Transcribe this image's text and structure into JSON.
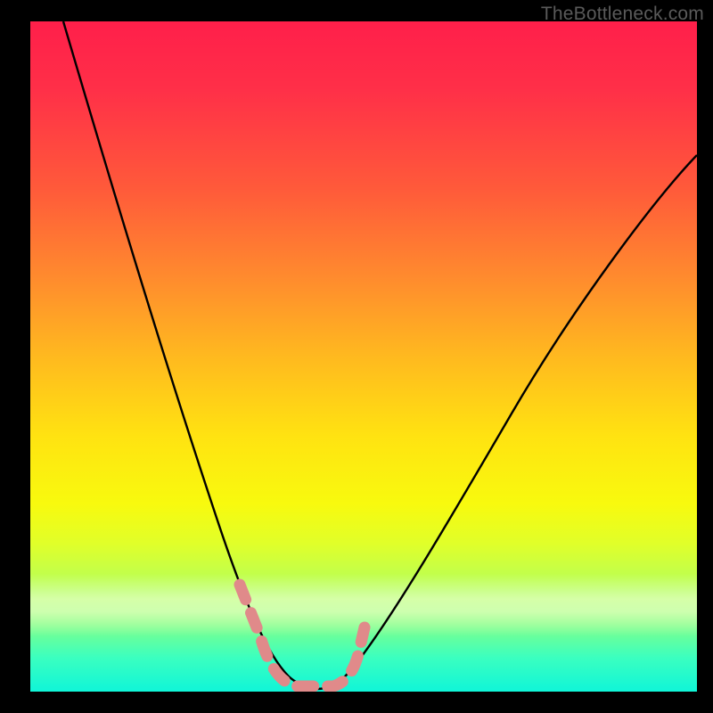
{
  "watermark": "TheBottleneck.com",
  "chart_data": {
    "type": "line",
    "title": "",
    "xlabel": "",
    "ylabel": "",
    "xlim": [
      0,
      100
    ],
    "ylim": [
      0,
      100
    ],
    "grid": false,
    "series": [
      {
        "name": "bottleneck-curve",
        "x": [
          5,
          10,
          15,
          20,
          25,
          30,
          33,
          36,
          38,
          40,
          42,
          44,
          46,
          50,
          55,
          60,
          65,
          70,
          75,
          80,
          85,
          90,
          95,
          100
        ],
        "y": [
          100,
          84,
          68,
          52,
          37,
          23,
          15,
          8,
          4,
          1,
          0,
          0,
          2,
          7,
          15,
          24,
          32,
          39,
          46,
          52,
          57,
          62,
          66,
          69
        ]
      }
    ],
    "annotations": {
      "minimum_marker": {
        "x_range": [
          31,
          48
        ],
        "style": "pink-dashed-U"
      }
    }
  }
}
